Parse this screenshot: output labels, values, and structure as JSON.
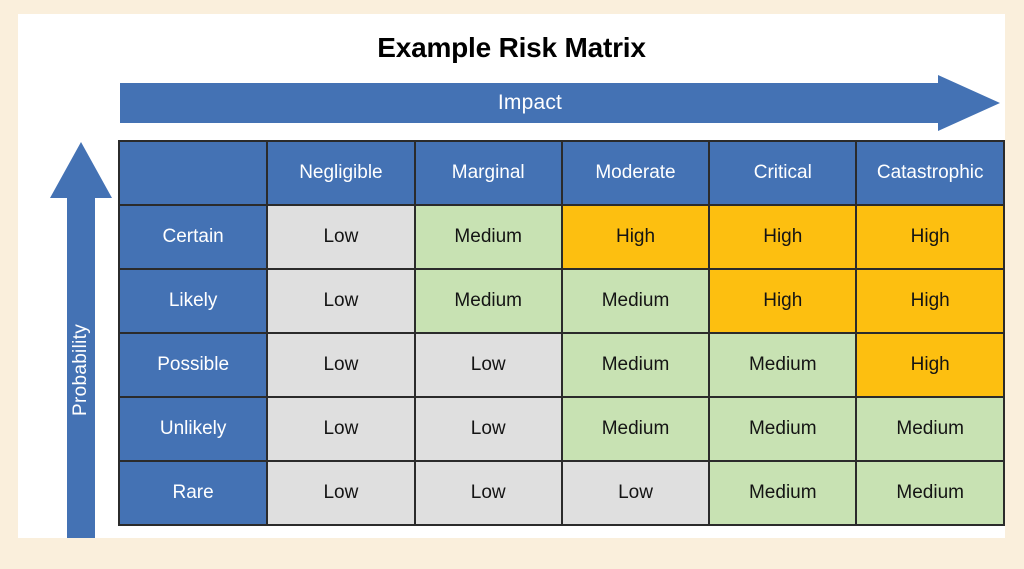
{
  "title": "Example Risk Matrix",
  "axes": {
    "x_axis_label": "Impact",
    "y_axis_label": "Probability"
  },
  "colors": {
    "page_background": "#faefdc",
    "canvas_background": "#ffffff",
    "accent_blue": "#4472b4",
    "low": "#dfdfdf",
    "medium": "#c8e2b3",
    "high": "#fdbf10",
    "grid_line": "#2b2b2b",
    "header_text": "#ffffff",
    "cell_text": "#141414"
  },
  "chart_data": {
    "type": "heatmap",
    "title": "Example Risk Matrix",
    "xlabel": "Impact",
    "ylabel": "Probability",
    "corner_label": "",
    "categories": [
      "Negligible",
      "Marginal",
      "Moderate",
      "Critical",
      "Catastrophic"
    ],
    "rows": [
      "Certain",
      "Likely",
      "Possible",
      "Unlikely",
      "Rare"
    ],
    "legend": [
      "Low",
      "Medium",
      "High"
    ],
    "grid": true,
    "legend_position": "none",
    "values": [
      [
        "Low",
        "Medium",
        "High",
        "High",
        "High"
      ],
      [
        "Low",
        "Medium",
        "Medium",
        "High",
        "High"
      ],
      [
        "Low",
        "Low",
        "Medium",
        "Medium",
        "High"
      ],
      [
        "Low",
        "Low",
        "Medium",
        "Medium",
        "Medium"
      ],
      [
        "Low",
        "Low",
        "Low",
        "Medium",
        "Medium"
      ]
    ]
  }
}
